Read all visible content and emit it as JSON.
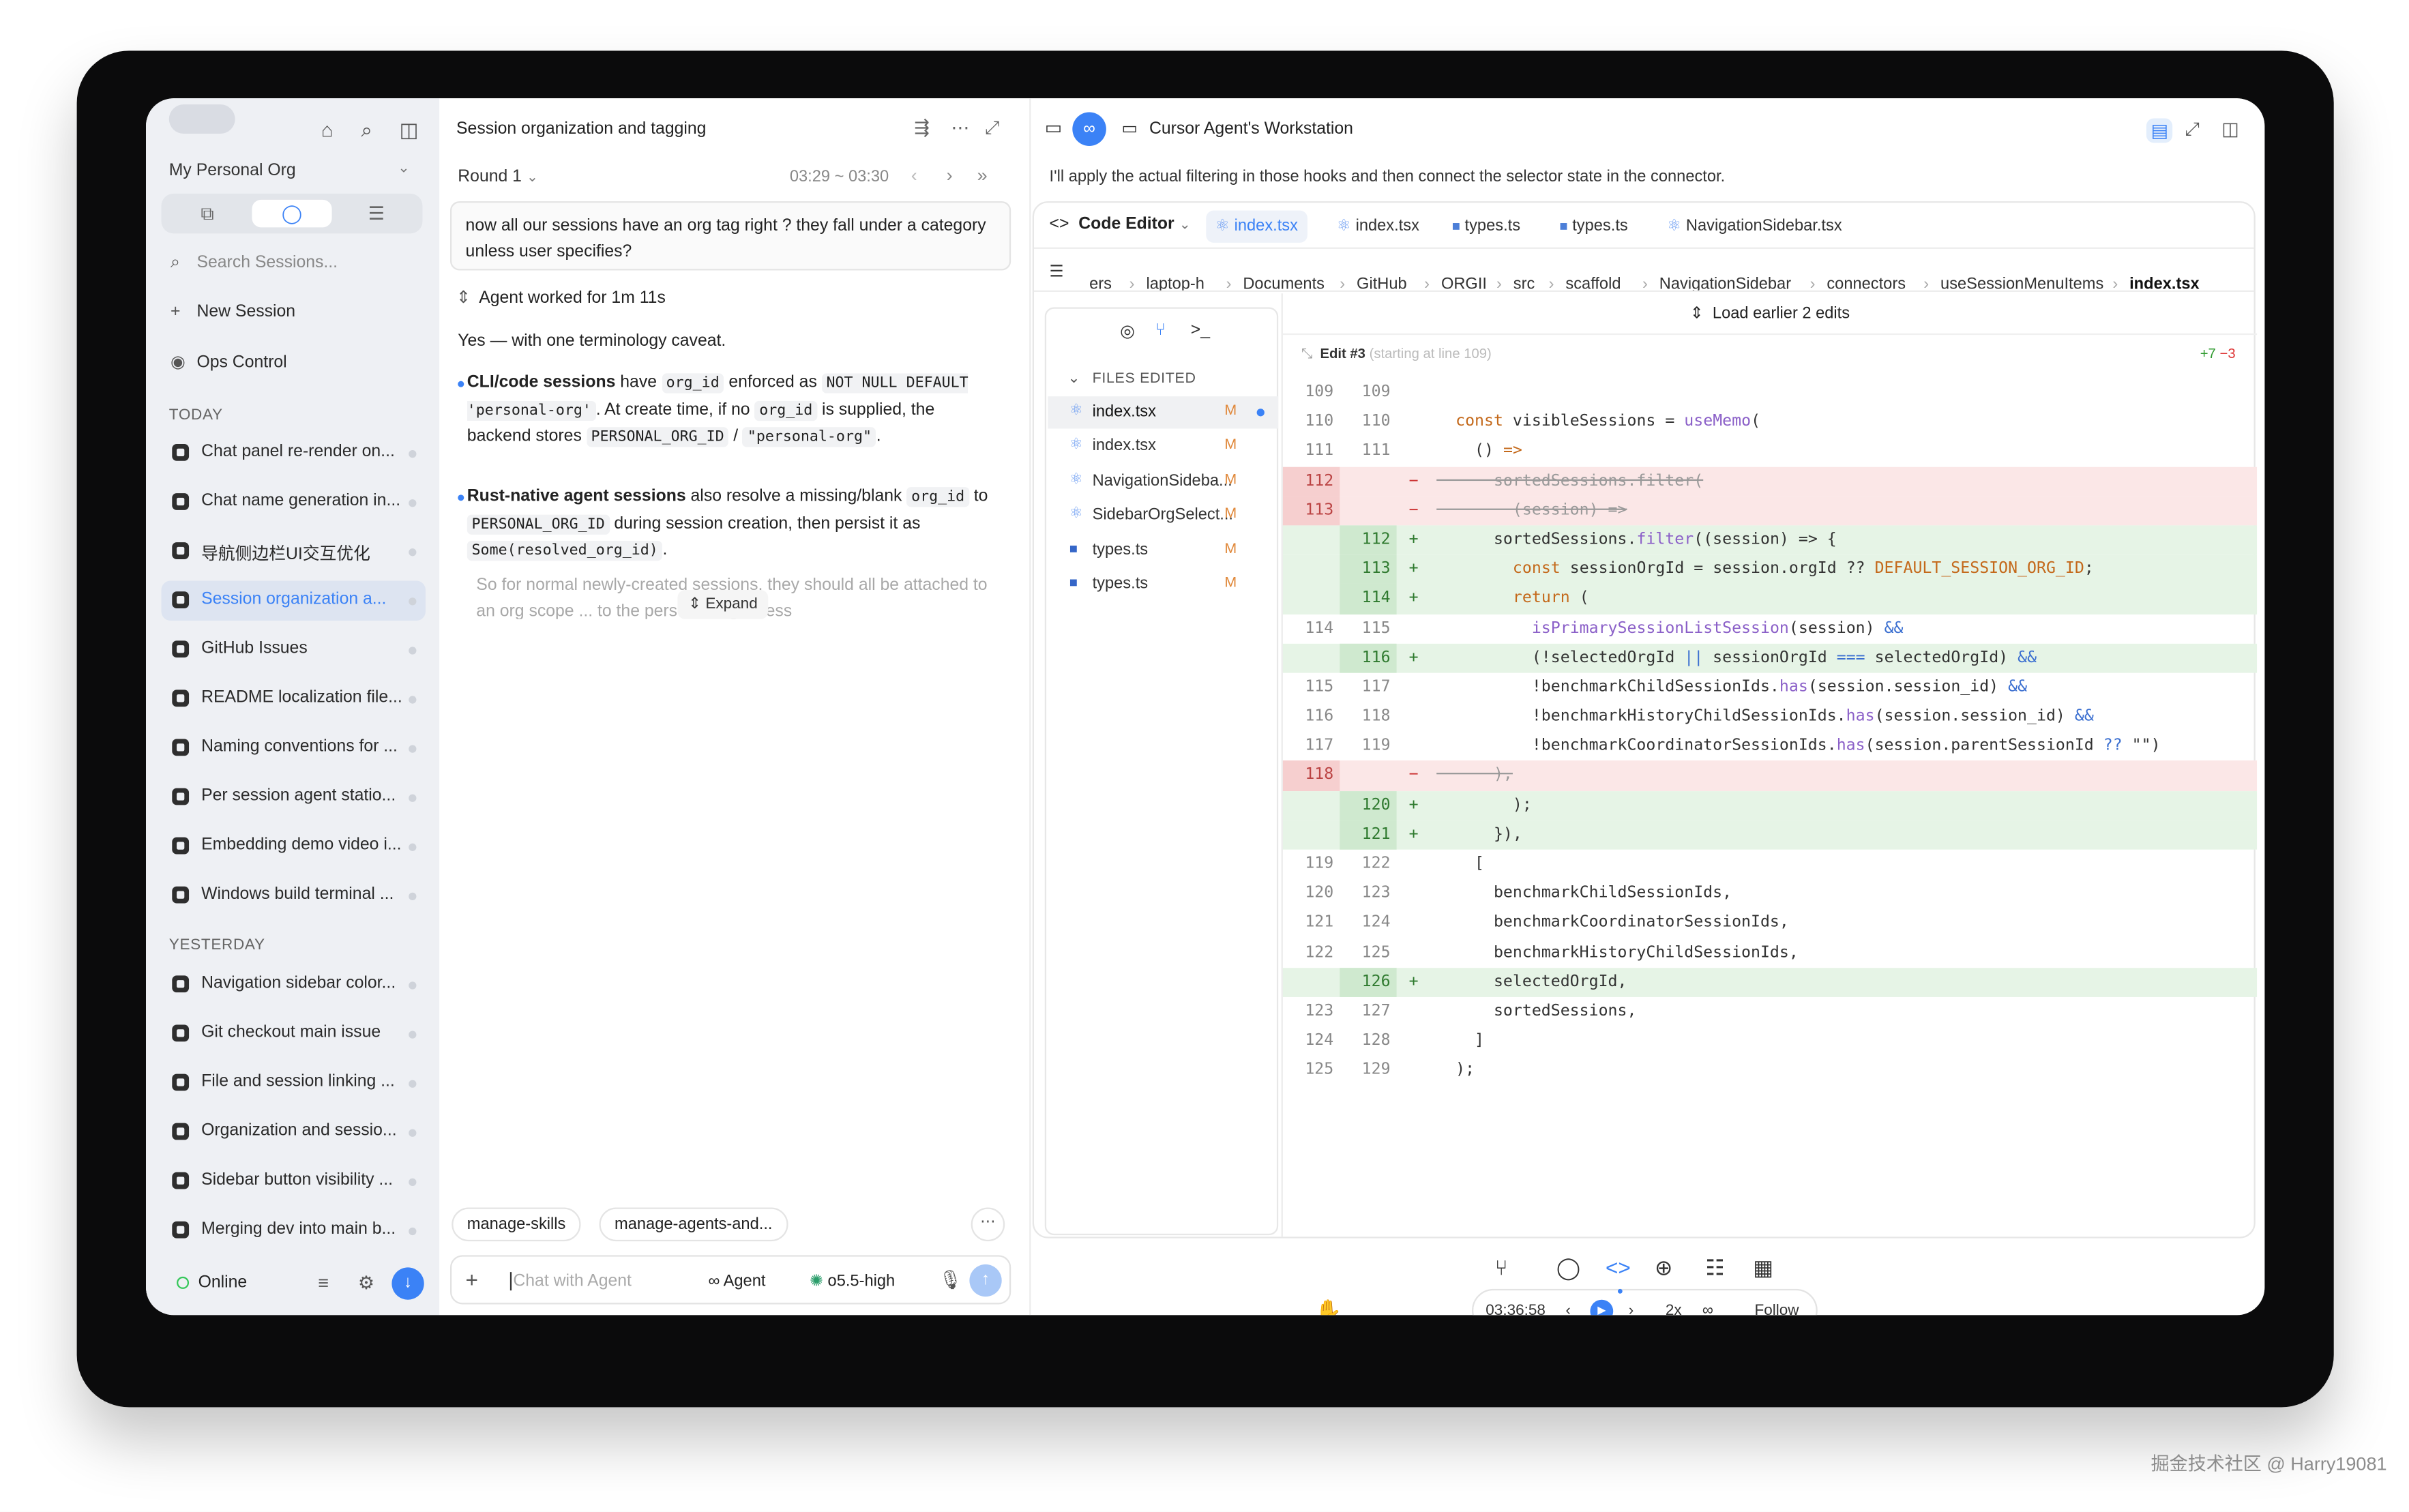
{
  "sidebar": {
    "org": "My Personal Org",
    "search_placeholder": "Search Sessions...",
    "new_session": "New Session",
    "ops_control": "Ops Control",
    "today_label": "TODAY",
    "yesterday_label": "YESTERDAY",
    "today": [
      "Chat panel re-render on...",
      "Chat name generation in...",
      "导航侧边栏UI交互优化",
      "Session organization a...",
      "GitHub Issues",
      "README localization file...",
      "Naming conventions for ...",
      "Per session agent statio...",
      "Embedding demo video i...",
      "Windows build terminal ..."
    ],
    "yesterday": [
      "Navigation sidebar color...",
      "Git checkout main issue",
      "File and session linking ...",
      "Organization and sessio...",
      "Sidebar button visibility ...",
      "Merging dev into main b..."
    ],
    "status": "Online"
  },
  "chat": {
    "title": "Session organization and tagging",
    "round": "Round 1",
    "time": "03:29 ~ 03:30",
    "question": "now all our sessions have an org tag right ? they fall under a category unless user specifies?",
    "worked": "Agent worked for 1m 11s",
    "intro": "Yes — with one terminology caveat.",
    "b1_bold": "CLI/code sessions",
    "b1_t1": " have ",
    "b1_c1": "org_id",
    "b1_t2": " enforced as ",
    "b1_c2": "NOT NULL DEFAULT 'personal-org'",
    "b1_t3": ". At create time, if no ",
    "b1_c3": "org_id",
    "b1_t4": " is supplied, the backend stores ",
    "b1_c4": "PERSONAL_ORG_ID",
    "b1_t5": " / ",
    "b1_c5": "\"personal-org\"",
    "b1_t6": ".",
    "b2_bold": "Rust-native agent sessions",
    "b2_t1": " also resolve a missing/blank ",
    "b2_c1": "org_id",
    "b2_t2": " to ",
    "b2_c2": "PERSONAL_ORG_ID",
    "b2_t3": " during session creation, then persist it as ",
    "b2_c3": "Some(resolved_org_id)",
    "b2_t4": ".",
    "faded": "So for normal newly-created sessions, they should all be attached to an org scope ... to the personal org unless",
    "expand": "Expand",
    "chips": [
      "manage-skills",
      "manage-agents-and..."
    ],
    "input_placeholder": "Chat with Agent",
    "agent": "Agent",
    "model": "o5.5-high"
  },
  "workstation": {
    "title": "Cursor Agent's Workstation",
    "message": "I'll apply the actual filtering in those hooks and then connect the selector state in the connector.",
    "code_editor": "Code Editor",
    "tabs": [
      "index.tsx",
      "index.tsx",
      "types.ts",
      "types.ts",
      "NavigationSidebar.tsx"
    ],
    "breadcrumbs": [
      "ers",
      "laptop-h",
      "Documents",
      "GitHub",
      "ORGII",
      "src",
      "scaffold",
      "NavigationSidebar",
      "connectors",
      "useSessionMenuItems",
      "index.tsx"
    ],
    "files_edited_label": "FILES EDITED",
    "files": [
      {
        "name": "index.tsx",
        "status": "M",
        "type": "react"
      },
      {
        "name": "index.tsx",
        "status": "M",
        "type": "react"
      },
      {
        "name": "NavigationSideba...",
        "status": "M",
        "type": "react"
      },
      {
        "name": "SidebarOrgSelect...",
        "status": "M",
        "type": "react"
      },
      {
        "name": "types.ts",
        "status": "M",
        "type": "ts"
      },
      {
        "name": "types.ts",
        "status": "M",
        "type": "ts"
      }
    ],
    "load_earlier": "Load earlier 2 edits",
    "edit_label": "Edit #3",
    "edit_sub": "(starting at line 109)",
    "added": "+7",
    "removed": "−3",
    "player": {
      "time": "03:36:58",
      "speed": "2x",
      "follow": "Follow"
    },
    "colors": {
      "accent": "#3b82f6",
      "add_bg": "#e6f4e6",
      "del_bg": "#fbe7e7"
    }
  }
}
